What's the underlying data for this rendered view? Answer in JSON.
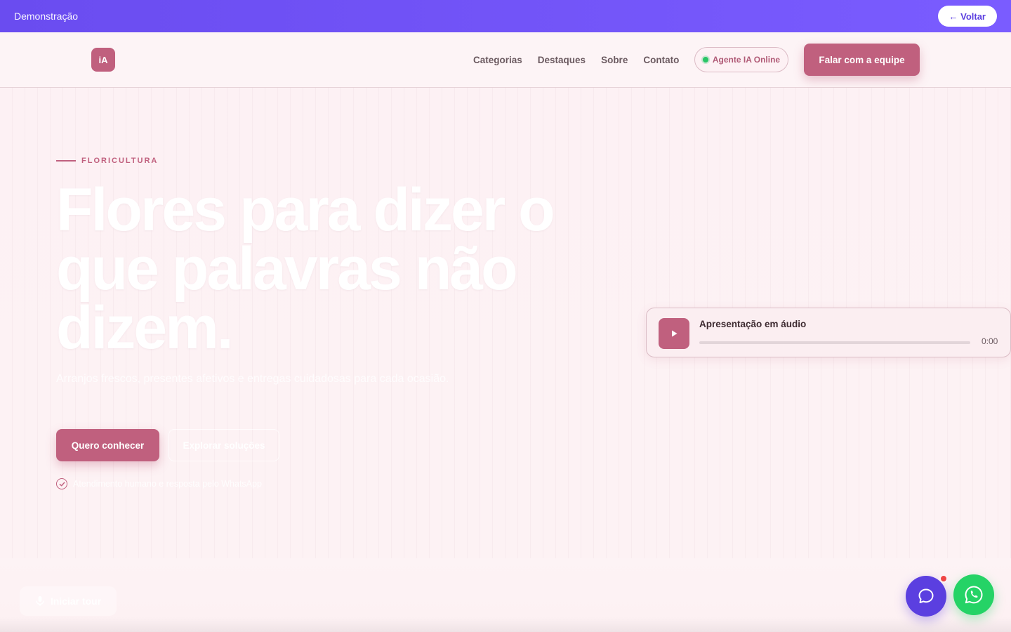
{
  "demo_bar": {
    "label": "Demonstração",
    "back_label": "← Voltar"
  },
  "header": {
    "logo_text": "iA",
    "nav": [
      "Categorias",
      "Destaques",
      "Sobre",
      "Contato"
    ],
    "agent_status": "Agente IA Online",
    "cta_label": "Falar com a equipe"
  },
  "hero": {
    "eyebrow": "FLORICULTURA",
    "title": "Flores para dizer o que palavras não dizem.",
    "subtitle": "Arranjos frescos, presentes afetivos e entregas cuidadosas para cada ocasião.",
    "primary_cta": "Quero conhecer",
    "secondary_cta": "Explorar soluções",
    "assurance": "Atendimento humano e resposta pelo WhatsApp"
  },
  "audio": {
    "title": "Apresentação em áudio",
    "time": "0:00",
    "progress": 0
  },
  "floating": {
    "tour_label": "Iniciar tour"
  },
  "icons": {
    "play": "play-icon",
    "check": "check-circle-icon",
    "chat": "chat-icon",
    "whatsapp": "whatsapp-icon",
    "mic": "mic-icon"
  },
  "colors": {
    "brand": "#c0607e",
    "demo_bar": "#6a4cf0",
    "chat": "#5b3fe0",
    "whatsapp": "#25d366",
    "online": "#29c566"
  }
}
